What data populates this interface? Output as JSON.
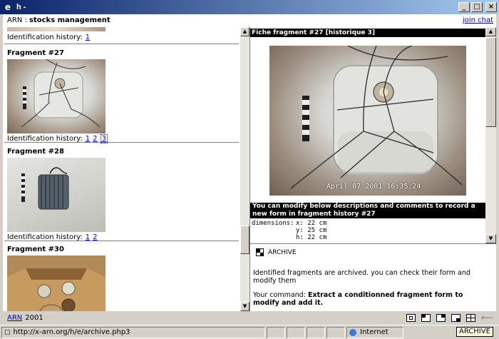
{
  "window": {
    "title": "h -"
  },
  "header": {
    "app_prefix": "ARN :",
    "app_name": "stocks management",
    "join_chat": "join chat"
  },
  "left": {
    "top_history_label": "Identification history:",
    "top_history_links": [
      "1"
    ],
    "fragments": [
      {
        "title": "Fragment #27",
        "history_label": "Identification history:",
        "links": [
          "1",
          "2",
          "3"
        ]
      },
      {
        "title": "Fragment #28",
        "history_label": "Identification history:",
        "links": [
          "1",
          "2"
        ]
      },
      {
        "title": "Fragment #30"
      }
    ]
  },
  "right": {
    "fiche_title": "Fiche fragment #27 [historique 3]",
    "photo_timestamp": "April 07 2001 16:35:24",
    "banner": "You can modify below descriptions and comments to record a new form in fragment history #27",
    "dimensions_label": "dimensions:",
    "dimensions": [
      {
        "axis": "x:",
        "value": "22 cm"
      },
      {
        "axis": "y:",
        "value": "25 cm"
      },
      {
        "axis": "h:",
        "value": "22 cm"
      }
    ]
  },
  "lower": {
    "archive_label": "ARCHIVE",
    "info_text": "Identified fragments are archived. you can check their form and modify them",
    "command_label": "Your command:",
    "command_text": "Extract a conditionned fragment form to modify and add it."
  },
  "footer": {
    "link": "ARN",
    "year": "2001"
  },
  "statusbar": {
    "url": "http://x-arn.org/h/e/archive.php3",
    "zone": "Internet",
    "tooltip": "ARCHIVE"
  }
}
